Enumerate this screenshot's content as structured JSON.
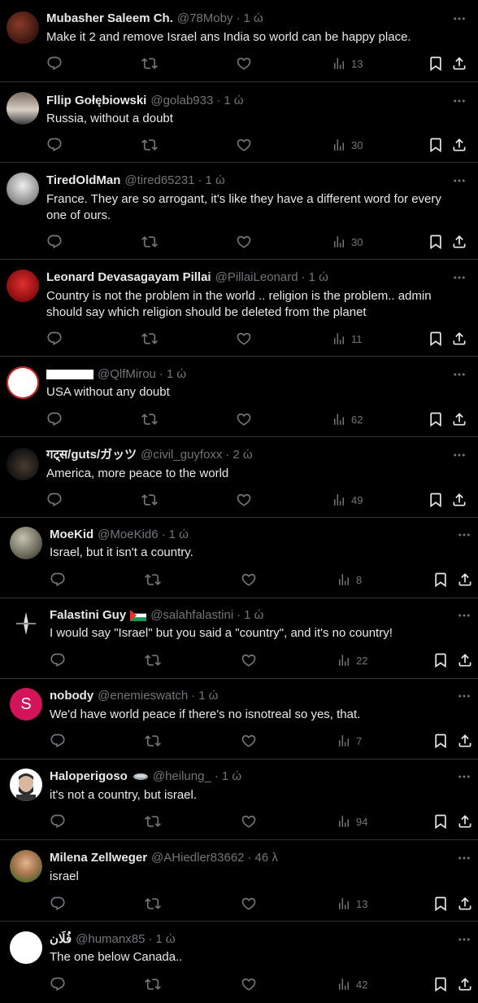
{
  "tweets": [
    {
      "name": "Mubasher Saleem Ch.",
      "handle": "@78Moby",
      "time": "1 ώ",
      "text": "Make it 2 and remove Israel ans India so world can be happy place.",
      "views": "13"
    },
    {
      "name": "Fllip Gołębiowski",
      "handle": "@golab933",
      "time": "1 ώ",
      "text": "Russia, without a doubt",
      "views": "30"
    },
    {
      "name": "TiredOldMan",
      "handle": "@tired65231",
      "time": "1 ώ",
      "text": "France. They are so arrogant, it's like they have a different word for every one of ours.",
      "views": "30"
    },
    {
      "name": "Leonard Devasagayam Pillai",
      "handle": "@PillaiLeonard",
      "time": "1 ώ",
      "text": "Country is not the problem in the world .. religion is the problem.. admin should say which religion should be deleted from the planet",
      "views": "11"
    },
    {
      "name": "",
      "handle": "@QlfMirou",
      "time": "1 ώ",
      "text": "USA without any doubt",
      "views": "62"
    },
    {
      "name": "गट्स/guts/ガッツ",
      "handle": "@civil_guyfoxx",
      "time": "2 ώ",
      "text": "America, more peace to the world",
      "views": "49"
    },
    {
      "name": "MoeKid",
      "handle": "@MoeKid6",
      "time": "1 ώ",
      "text": "Israel, but it isn't a country.",
      "views": "8"
    },
    {
      "name": "Falastini Guy",
      "handle": "@salahfalastini",
      "time": "1 ώ",
      "text": "I would say \"Israel\" but you said a \"country\", and it's no country!",
      "views": "22"
    },
    {
      "name": "nobody",
      "handle": "@enemieswatch",
      "time": "1 ώ",
      "text": "We'd have world peace if there's no isnotreal so yes, that.",
      "views": "7",
      "avatar_letter": "S"
    },
    {
      "name": "Haloperigoso",
      "handle": "@heilung_",
      "time": "1 ώ",
      "text": "it's not a country, but israel.",
      "views": "94"
    },
    {
      "name": "Milena Zellweger",
      "handle": "@AHiedler83662",
      "time": "46 λ",
      "text": "israel",
      "views": "13"
    },
    {
      "name": "فُلَان",
      "handle": "@humanx85",
      "time": "1 ώ",
      "text": "The one below Canada..",
      "views": "42"
    }
  ],
  "icons": [
    "reply-icon",
    "retweet-icon",
    "like-icon",
    "views-icon",
    "bookmark-icon",
    "share-icon",
    "more-icon"
  ],
  "colors": {
    "background": "#000000",
    "text": "#e7e9ea",
    "muted": "#71767b",
    "divider": "#2f3336",
    "nobody_avatar": "#d3135a"
  }
}
